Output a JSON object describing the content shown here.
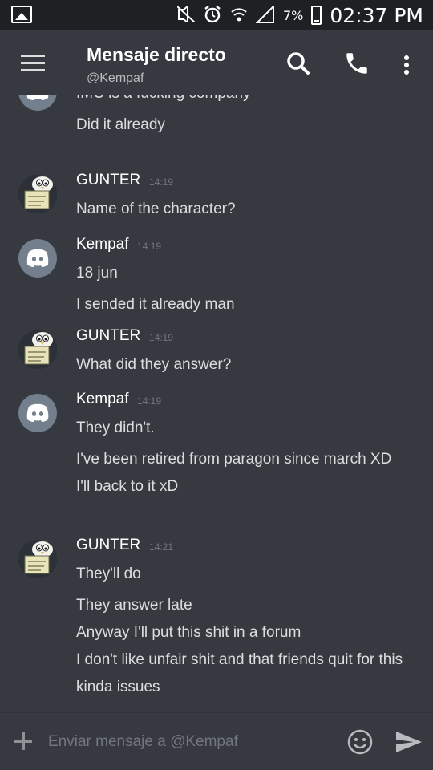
{
  "status_bar": {
    "battery": "7%",
    "time": "02:37 PM"
  },
  "header": {
    "title": "Mensaje directo",
    "subtitle": "@Kempaf"
  },
  "messages": [
    {
      "author": "",
      "time": "",
      "avatar": "discord-logo",
      "lines": [
        "IMC is a fucking company",
        "Did it already"
      ]
    },
    {
      "author": "GUNTER",
      "time": "14:19",
      "avatar": "gunter-penguin",
      "lines": [
        "Name of the character?"
      ]
    },
    {
      "author": "Kempaf",
      "time": "14:19",
      "avatar": "discord-logo",
      "lines": [
        "18 jun",
        "I sended it already man"
      ]
    },
    {
      "author": "GUNTER",
      "time": "14:19",
      "avatar": "gunter-penguin",
      "lines": [
        "What did they answer?"
      ]
    },
    {
      "author": "Kempaf",
      "time": "14:19",
      "avatar": "discord-logo",
      "lines": [
        "They didn't.",
        "I've been retired from paragon since march XD",
        "I'll back to it xD"
      ]
    },
    {
      "author": "GUNTER",
      "time": "14:21",
      "avatar": "gunter-penguin",
      "lines": [
        "They'll do",
        "They answer late",
        "Anyway I'll put this shit in a forum",
        "I don't like unfair shit and that friends quit for this kinda issues"
      ]
    }
  ],
  "composer": {
    "placeholder": "Enviar mensaje a @Kempaf",
    "value": ""
  },
  "colors": {
    "background": "#36393f",
    "status_bar": "#1e2124",
    "text": "#dcddde",
    "muted": "#72767d",
    "discord_avatar": "#747f8d"
  }
}
